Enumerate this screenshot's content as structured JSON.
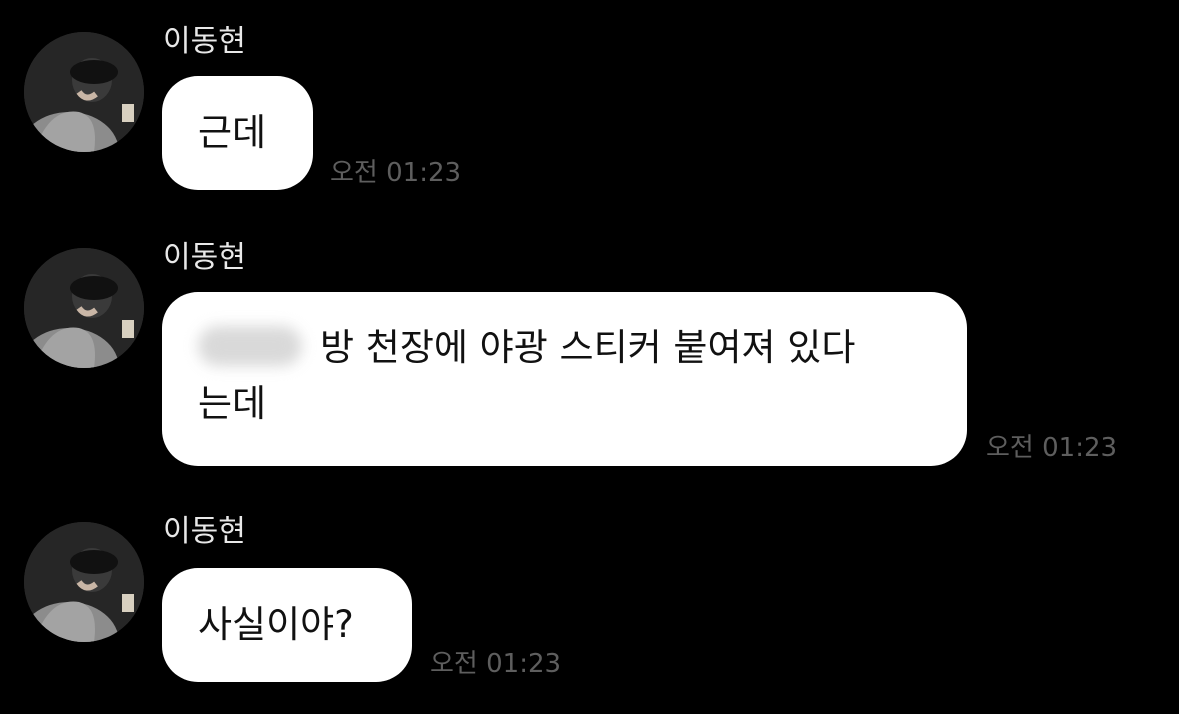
{
  "chat": {
    "messages": [
      {
        "sender": "이동현",
        "lines": [
          "근데"
        ],
        "time": "오전 01:23"
      },
      {
        "sender": "이동현",
        "lines": [
          "방 천장에 야광 스티커 붙여져 있다",
          "는데"
        ],
        "time": "오전 01:23",
        "redacted_prefix": true
      },
      {
        "sender": "이동현",
        "lines": [
          "사실이야?"
        ],
        "time": "오전 01:23"
      }
    ]
  },
  "icons": {
    "avatar": "profile-photo"
  },
  "colors": {
    "background": "#000000",
    "bubble": "#ffffff",
    "bubble_text": "#111111",
    "sender_text": "#e8e8e8",
    "time_text": "#5e5e5e"
  }
}
